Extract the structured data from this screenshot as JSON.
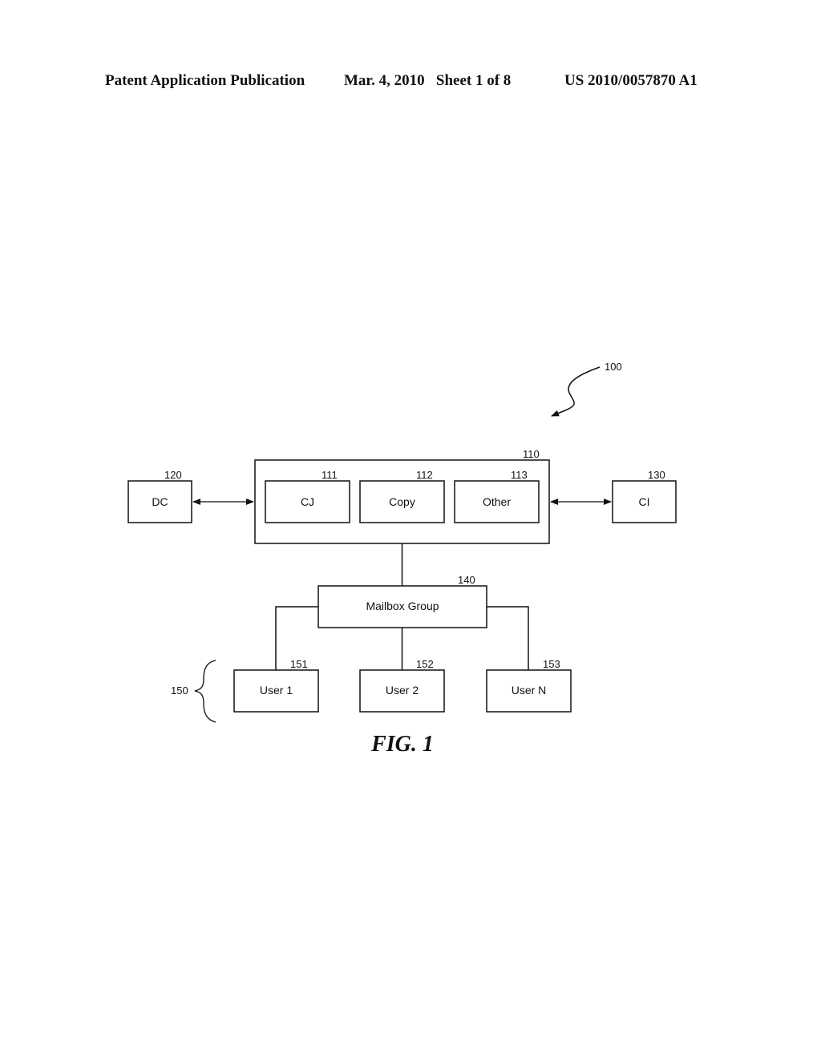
{
  "header": {
    "publication": "Patent Application Publication",
    "date_sheet": "Mar. 4, 2010   Sheet 1 of 8",
    "patent_number": "US 2010/0057870 A1"
  },
  "diagram": {
    "system_ref": "100",
    "server": {
      "ref": "110",
      "modules": [
        {
          "ref": "111",
          "label": "CJ"
        },
        {
          "ref": "112",
          "label": "Copy"
        },
        {
          "ref": "113",
          "label": "Other"
        }
      ]
    },
    "dc": {
      "ref": "120",
      "label": "DC"
    },
    "ci": {
      "ref": "130",
      "label": "CI"
    },
    "mailbox_group": {
      "ref": "140",
      "label": "Mailbox Group"
    },
    "users_group_ref": "150",
    "users": [
      {
        "ref": "151",
        "label": "User 1"
      },
      {
        "ref": "152",
        "label": "User 2"
      },
      {
        "ref": "153",
        "label": "User N"
      }
    ],
    "figure_caption": "FIG. 1"
  }
}
